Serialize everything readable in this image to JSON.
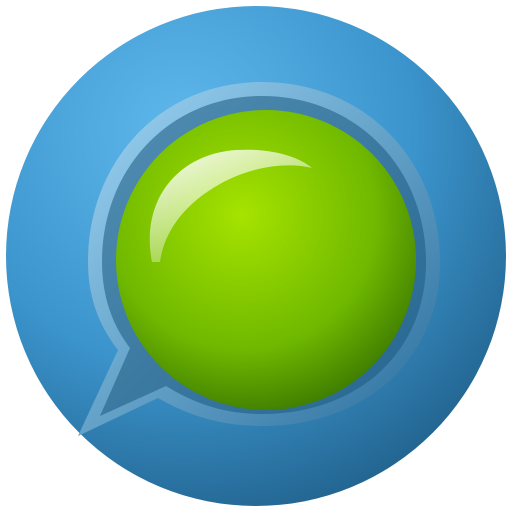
{
  "icon": {
    "name": "chat-bubble-icon",
    "colors": {
      "background": "#ffffff",
      "circle_light": "#5fb8ec",
      "circle_mid": "#3b94cc",
      "circle_dark": "#1f5d87",
      "rim_light": "#9fd6f5",
      "rim_dark": "#2a6e9c",
      "bubble_light": "#a6e300",
      "bubble_mid": "#6fb800",
      "bubble_dark": "#2f6a00",
      "highlight": "#ffffff"
    }
  }
}
